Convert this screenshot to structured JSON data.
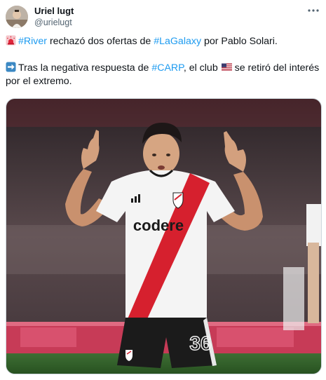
{
  "author": {
    "display_name": "Uriel lugt",
    "handle": "@urielugt"
  },
  "tweet": {
    "line1": {
      "emoji": "red-siren-emoji",
      "hashtag1": "#River",
      "text1": " rechazó dos ofertas de ",
      "hashtag2": "#LaGalaxy",
      "text2": " por Pablo Solari."
    },
    "line2": {
      "emoji": "right-arrow-emoji",
      "text1": "Tras la negativa respuesta de ",
      "hashtag": "#CARP",
      "text2": ", el club ",
      "flag_emoji": "us-flag-emoji",
      "text3": " se retiró del interés por el extremo."
    }
  },
  "media": {
    "sponsor": "codere",
    "shorts_number": "36",
    "description_icons": [
      "player-photo"
    ]
  },
  "colors": {
    "link": "#1d9bf0",
    "text": "#0f1419",
    "secondary": "#536471",
    "jersey_red": "#d6202e"
  }
}
